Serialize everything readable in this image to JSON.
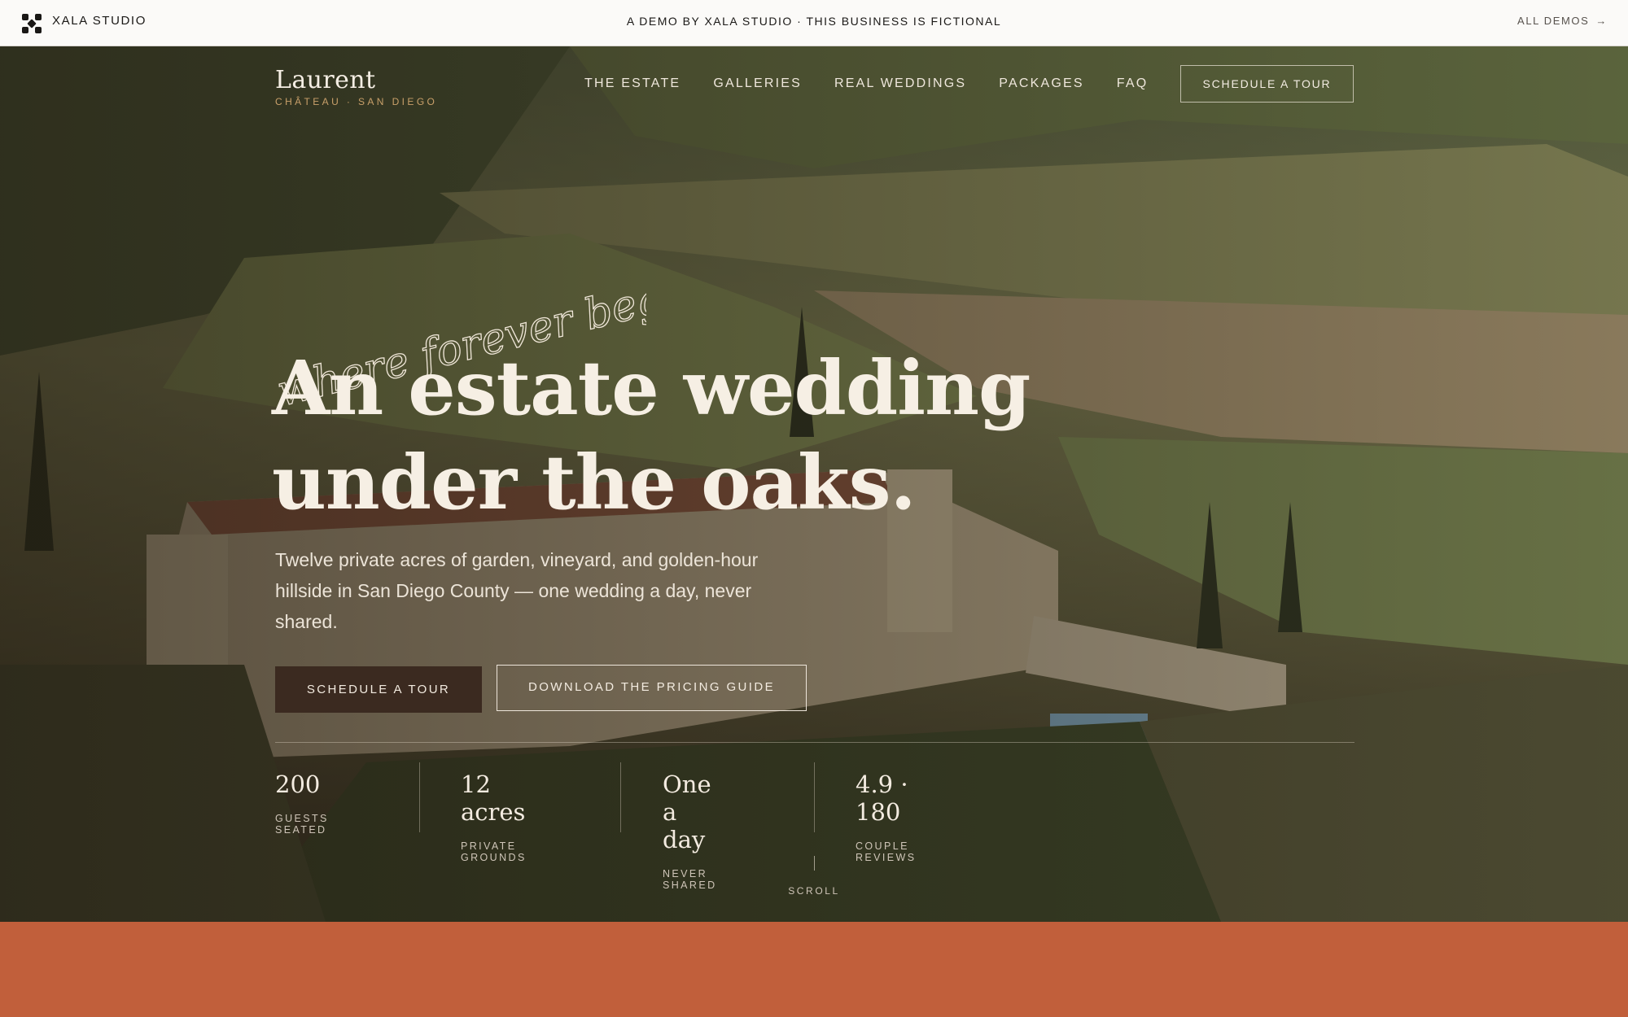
{
  "demo_bar": {
    "brand": "XALA STUDIO",
    "notice": "A DEMO BY XALA STUDIO · THIS BUSINESS IS FICTIONAL",
    "all_demos": "ALL DEMOS",
    "all_demos_arrow": "→"
  },
  "site": {
    "brand_name": "Laurent",
    "brand_sub": "CHÂTEAU · SAN DIEGO",
    "nav": [
      "THE ESTATE",
      "GALLERIES",
      "REAL WEDDINGS",
      "PACKAGES",
      "FAQ"
    ],
    "nav_cta": "SCHEDULE A TOUR"
  },
  "hero": {
    "script_tagline": "where forever begins",
    "headline_line1": "An estate wedding",
    "headline_line2": "under the oaks.",
    "lede": "Twelve private acres of garden, vineyard, and golden-hour hillside in San Diego County — one wedding a day, never shared.",
    "primary_cta": "SCHEDULE A TOUR",
    "secondary_cta": "DOWNLOAD THE PRICING GUIDE",
    "stats": [
      {
        "value": "200",
        "label": "GUESTS SEATED"
      },
      {
        "value": "12 acres",
        "label": "PRIVATE GROUNDS"
      },
      {
        "value": "One a day",
        "label": "NEVER SHARED"
      },
      {
        "value": "4.9 · 180",
        "label": "COUPLE REVIEWS"
      }
    ],
    "scroll_label": "SCROLL"
  },
  "colors": {
    "accent_gold": "#c9a06a",
    "primary_button": "#3b2a20",
    "band": "#c15f3b",
    "cream_text": "#f6efe4"
  }
}
